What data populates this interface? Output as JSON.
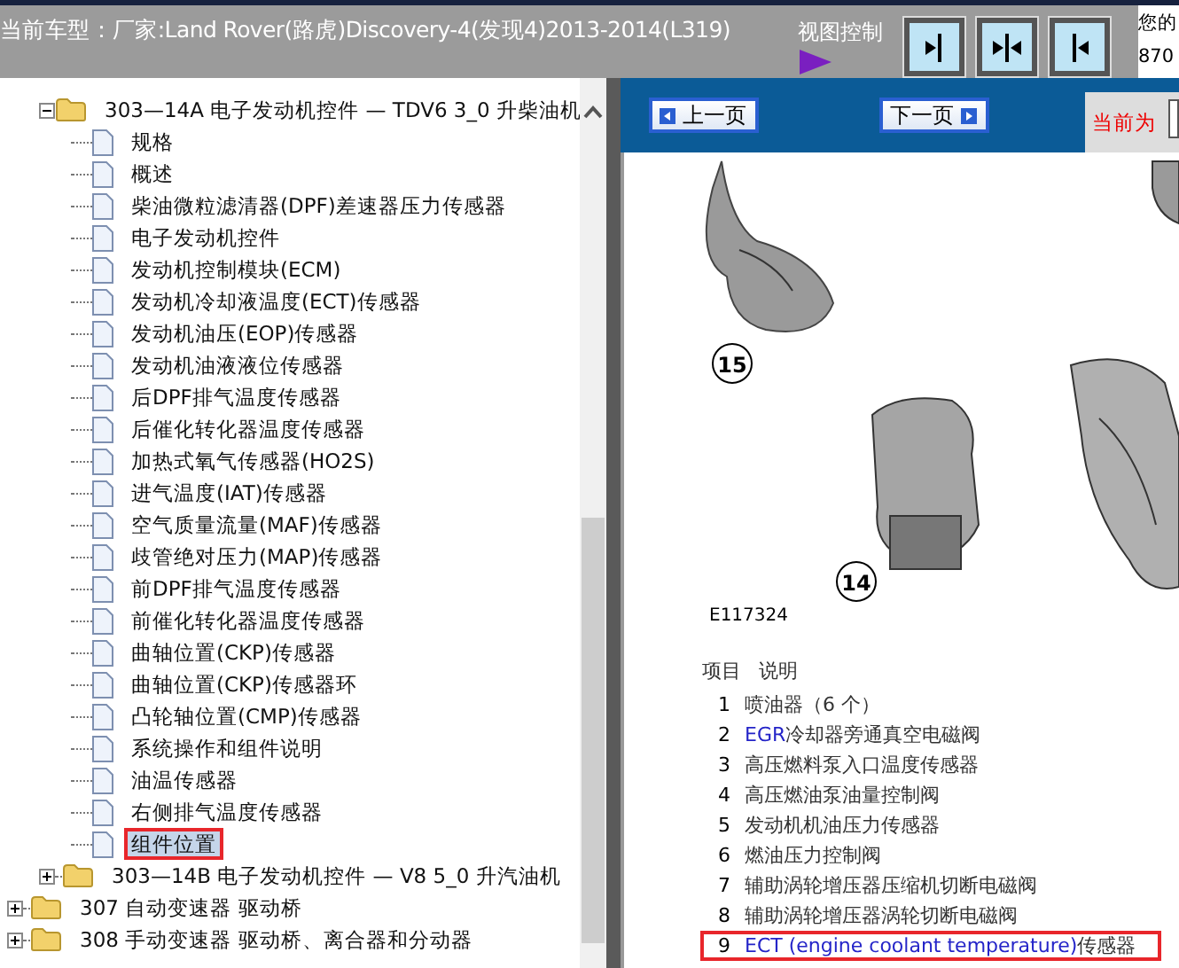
{
  "header": {
    "title": "当前车型：厂家:Land Rover(路虎)Discovery-4(发现4)2013-2014(L319)",
    "view_control_label": "视图控制",
    "view_buttons": [
      {
        "kind": "right"
      },
      {
        "kind": "split"
      },
      {
        "kind": "left"
      }
    ],
    "side_texts": [
      "您的",
      "870"
    ]
  },
  "tree": {
    "items": [
      {
        "children": [
          {
            "label": "303—14A 电子发动机控件 — TDV6 3_0 升柴油机",
            "expanded": true,
            "children": [
              {
                "label": "规格",
                "selected": false,
                "highlighted": false
              },
              {
                "label": "概述",
                "selected": false,
                "highlighted": false
              },
              {
                "label": "柴油微粒滤清器(DPF)差速器压力传感器",
                "selected": false,
                "highlighted": false
              },
              {
                "label": "电子发动机控件",
                "selected": false,
                "highlighted": false
              },
              {
                "label": "发动机控制模块(ECM)",
                "selected": false,
                "highlighted": false
              },
              {
                "label": "发动机冷却液温度(ECT)传感器",
                "selected": false,
                "highlighted": false
              },
              {
                "label": "发动机油压(EOP)传感器",
                "selected": false,
                "highlighted": false
              },
              {
                "label": "发动机油液液位传感器",
                "selected": false,
                "highlighted": false
              },
              {
                "label": "后DPF排气温度传感器",
                "selected": false,
                "highlighted": false
              },
              {
                "label": "后催化转化器温度传感器",
                "selected": false,
                "highlighted": false
              },
              {
                "label": "加热式氧气传感器(HO2S)",
                "selected": false,
                "highlighted": false
              },
              {
                "label": "进气温度(IAT)传感器",
                "selected": false,
                "highlighted": false
              },
              {
                "label": "空气质量流量(MAF)传感器",
                "selected": false,
                "highlighted": false
              },
              {
                "label": "歧管绝对压力(MAP)传感器",
                "selected": false,
                "highlighted": false
              },
              {
                "label": "前DPF排气温度传感器",
                "selected": false,
                "highlighted": false
              },
              {
                "label": "前催化转化器温度传感器",
                "selected": false,
                "highlighted": false
              },
              {
                "label": "曲轴位置(CKP)传感器",
                "selected": false,
                "highlighted": false
              },
              {
                "label": "曲轴位置(CKP)传感器环",
                "selected": false,
                "highlighted": false
              },
              {
                "label": "凸轮轴位置(CMP)传感器",
                "selected": false,
                "highlighted": false
              },
              {
                "label": "系统操作和组件说明",
                "selected": false,
                "highlighted": false
              },
              {
                "label": "油温传感器",
                "selected": false,
                "highlighted": false
              },
              {
                "label": "右侧排气温度传感器",
                "selected": false,
                "highlighted": false
              },
              {
                "label": "组件位置",
                "selected": true,
                "highlighted": true
              }
            ]
          },
          {
            "label": "303—14B 电子发动机控件 — V8 5_0 升汽油机",
            "expanded": false
          }
        ]
      },
      {
        "label": "307 自动变速器 驱动桥",
        "expanded": false
      },
      {
        "label": "308 手动变速器 驱动桥、离合器和分动器",
        "expanded": false
      }
    ]
  },
  "toolbar": {
    "prev": "上一页",
    "next": "下一页",
    "current_label": "当前为"
  },
  "document": {
    "callouts": [
      "15",
      "14"
    ],
    "figure_id": "E117324",
    "legend_columns": [
      "项目",
      "说明"
    ],
    "legend": [
      {
        "number": "1",
        "text": "喷油器（6 个）",
        "highlighted": false
      },
      {
        "number": "2",
        "term": "EGR",
        "text": "冷却器旁通真空电磁阀",
        "highlighted": false
      },
      {
        "number": "3",
        "text": "高压燃料泵入口温度传感器",
        "highlighted": false
      },
      {
        "number": "4",
        "text": "高压燃油泵油量控制阀",
        "highlighted": false
      },
      {
        "number": "5",
        "text": "发动机机油压力传感器",
        "highlighted": false
      },
      {
        "number": "6",
        "text": "燃油压力控制阀",
        "highlighted": false
      },
      {
        "number": "7",
        "text": "辅助涡轮增压器压缩机切断电磁阀",
        "highlighted": false
      },
      {
        "number": "8",
        "text": "辅助涡轮增压器涡轮切断电磁阀",
        "highlighted": false
      },
      {
        "number": "9",
        "term": "ECT (engine coolant temperature)",
        "text": "传感器",
        "highlighted": true
      }
    ]
  }
}
